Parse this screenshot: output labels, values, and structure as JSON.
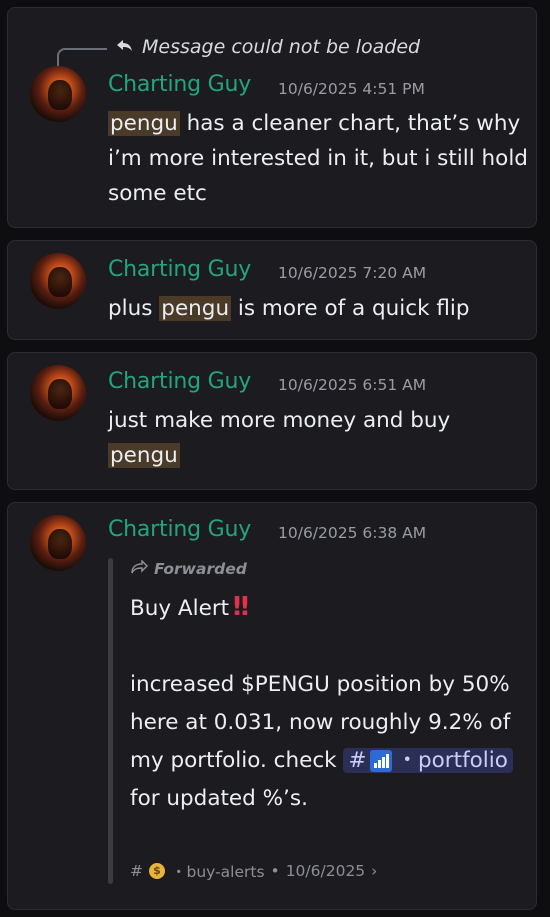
{
  "messages": [
    {
      "reply": "Message could not be loaded",
      "author": "Charting Guy",
      "timestamp": "10/6/2025 4:51 PM",
      "highlight": "pengu",
      "text_rest": " has a cleaner chart, that’s why i’m more interested in it, but i still hold some etc"
    },
    {
      "author": "Charting Guy",
      "timestamp": "10/6/2025 7:20 AM",
      "text_before": "plus ",
      "highlight": "pengu",
      "text_after": " is more of a quick flip"
    },
    {
      "author": "Charting Guy",
      "timestamp": "10/6/2025 6:51 AM",
      "text_before": "just make more money and buy ",
      "highlight": "pengu"
    },
    {
      "author": "Charting Guy",
      "timestamp": "10/6/2025 6:38 AM",
      "forwarded": {
        "label": "Forwarded",
        "alert_title": "Buy Alert",
        "body_before": "increased $PENGU position by 50% here at 0.031, now roughly 9.2% of my portfolio. check ",
        "mention_hash": "#",
        "mention_sep": "・",
        "mention_channel": "portfolio",
        "body_after": " for updated %’s.",
        "meta_hash": "#",
        "meta_channel": "・buy-alerts",
        "meta_dot": "•",
        "meta_date": "10/6/2025",
        "meta_chevron": "›"
      }
    }
  ],
  "colors": {
    "author": "#23a57c",
    "mention_bg": "#2b2f56",
    "highlight_bg": "#4a3a28"
  }
}
